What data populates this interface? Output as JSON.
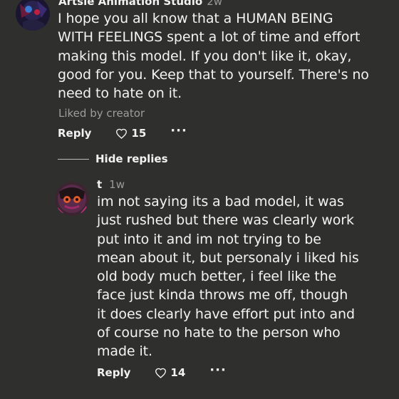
{
  "comment": {
    "author": "Artsie Animation Studio",
    "time": "2w",
    "lines": [
      "I hope you all know that a HUMAN BEING",
      "WITH FEELINGS spent a lot of time and effort",
      "making this model. If you don't like it, okay,",
      "good for you. Keep that to yourself. There's no",
      "need to hate on it."
    ],
    "liked_by": "Liked by creator",
    "reply_label": "Reply",
    "likes": "15",
    "more": "···",
    "avatar_icon": "avatar-icon"
  },
  "hide_replies_label": "Hide replies",
  "reply": {
    "author": "t",
    "time": "1w",
    "lines": [
      "im not saying its a bad model, it was",
      "just rushed but there was clearly work",
      "put into it and im not trying to be",
      "mean about it, but personaly i liked his",
      "old body much better, i feel like the",
      "face just kinda throws me off, though",
      "it does clearly have effort put into and",
      "of course no hate to the person who",
      "made it."
    ],
    "reply_label": "Reply",
    "likes": "14",
    "more": "···",
    "avatar_icon": "avatar-icon"
  },
  "colors": {
    "background": "#2f2f2e",
    "text": "#f2f2f2",
    "muted": "#9a9a9a"
  }
}
